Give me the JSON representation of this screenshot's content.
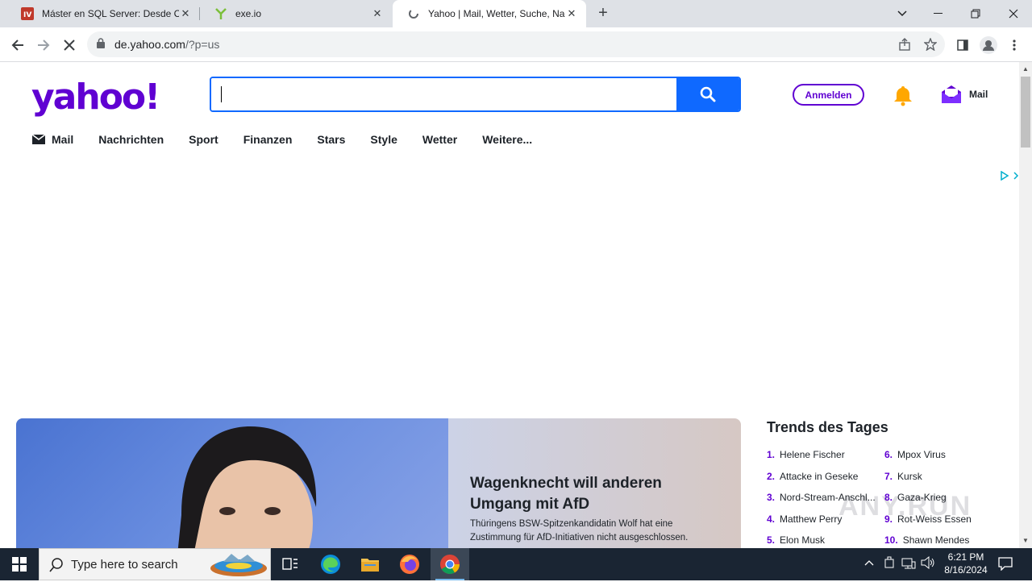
{
  "browser": {
    "tabs": [
      {
        "title": "Máster en SQL Server: Desde Cer",
        "icon": "udemy-icon"
      },
      {
        "title": "exe.io",
        "icon": "exeio-icon"
      },
      {
        "title": "Yahoo | Mail, Wetter, Suche, Nac",
        "icon": "loading-icon",
        "active": true
      }
    ],
    "url_host": "de.yahoo.com",
    "url_path": "/?p=us"
  },
  "yahoo": {
    "logo_text": "yahoo!",
    "search_placeholder": "",
    "signin_label": "Anmelden",
    "mail_label": "Mail",
    "nav": [
      "Mail",
      "Nachrichten",
      "Sport",
      "Finanzen",
      "Stars",
      "Style",
      "Wetter",
      "Weitere..."
    ],
    "hero": {
      "headline": "Wagenknecht will anderen Umgang mit AfD",
      "summary": "Thüringens BSW-Spitzenkandidatin Wolf hat eine Zustimmung für AfD-Initiativen nicht ausgeschlossen."
    },
    "trends_title": "Trends des Tages",
    "trends": [
      {
        "n": "1.",
        "label": "Helene Fischer"
      },
      {
        "n": "2.",
        "label": "Attacke in Geseke"
      },
      {
        "n": "3.",
        "label": "Nord-Stream-Anschl..."
      },
      {
        "n": "4.",
        "label": "Matthew Perry"
      },
      {
        "n": "5.",
        "label": "Elon Musk"
      },
      {
        "n": "6.",
        "label": "Mpox Virus"
      },
      {
        "n": "7.",
        "label": "Kursk"
      },
      {
        "n": "8.",
        "label": "Gaza-Krieg"
      },
      {
        "n": "9.",
        "label": "Rot-Weiss Essen"
      },
      {
        "n": "10.",
        "label": "Shawn Mendes"
      }
    ],
    "brand_color": "#6001d2",
    "search_color": "#0f69ff"
  },
  "watermark": "ANY.RUN",
  "taskbar": {
    "search_placeholder": "Type here to search",
    "time": "6:21 PM",
    "date": "8/16/2024"
  }
}
